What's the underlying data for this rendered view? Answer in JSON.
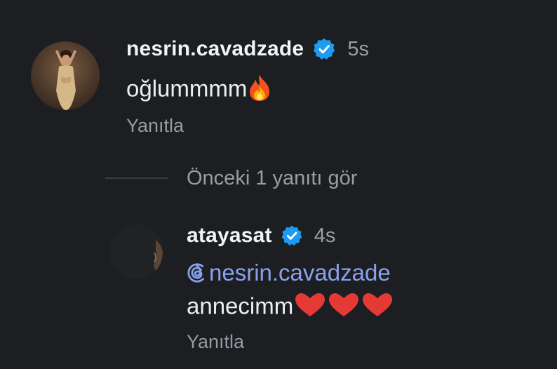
{
  "comments": [
    {
      "username": "nesrin.cavadzade",
      "verified": true,
      "time": "5s",
      "text": "oğlummmm",
      "emoji": "fire",
      "reply_label": "Yanıtla"
    },
    {
      "username": "atayasat",
      "verified": true,
      "time": "4s",
      "mention": "nesrin.cavadzade",
      "text": "annecimm",
      "emoji": "three-red-hearts",
      "reply_label": "Yanıtla"
    }
  ],
  "more_replies_label": "Önceki 1 yanıtı gör",
  "colors": {
    "background": "#1c1e22",
    "verified_blue": "#1d9bf0",
    "mention": "#8aa0ee",
    "secondary_text": "#9a9da3"
  }
}
